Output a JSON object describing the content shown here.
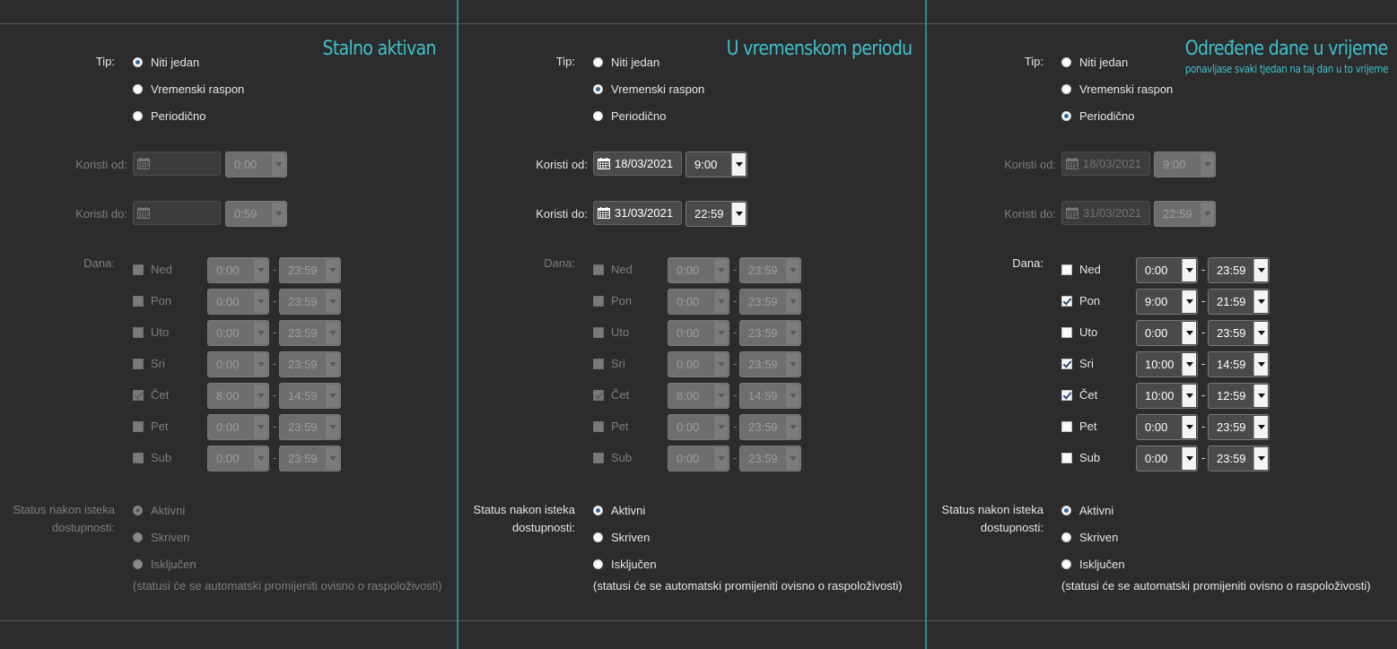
{
  "labels": {
    "tip": "Tip:",
    "koristi_od": "Koristi od:",
    "koristi_do": "Koristi do:",
    "dana": "Dana:",
    "status_line1": "Status nakon isteka",
    "status_line2": "dostupnosti:"
  },
  "type_options": [
    "Niti jedan",
    "Vremenski raspon",
    "Periodično"
  ],
  "status_options": [
    "Aktivni",
    "Skriven",
    "Isključen"
  ],
  "note": "(statusi će se automatski promijeniti ovisno o raspoloživosti)",
  "dash": "-",
  "panels": [
    {
      "title": "Stalno aktivan",
      "subtitle": "",
      "selected_type": 0,
      "from_date": "",
      "from_time": "0:00",
      "to_date": "",
      "to_time": "0:59",
      "days": [
        {
          "label": "Ned",
          "checked": false,
          "start": "0:00",
          "end": "23:59"
        },
        {
          "label": "Pon",
          "checked": false,
          "start": "0:00",
          "end": "23:59"
        },
        {
          "label": "Uto",
          "checked": false,
          "start": "0:00",
          "end": "23:59"
        },
        {
          "label": "Sri",
          "checked": false,
          "start": "0:00",
          "end": "23:59"
        },
        {
          "label": "Čet",
          "checked": true,
          "start": "8:00",
          "end": "14:59"
        },
        {
          "label": "Pet",
          "checked": false,
          "start": "0:00",
          "end": "23:59"
        },
        {
          "label": "Sub",
          "checked": false,
          "start": "0:00",
          "end": "23:59"
        }
      ],
      "status_selected": 0
    },
    {
      "title": "U vremenskom periodu",
      "subtitle": "",
      "selected_type": 1,
      "from_date": "18/03/2021",
      "from_time": "9:00",
      "to_date": "31/03/2021",
      "to_time": "22:59",
      "days": [
        {
          "label": "Ned",
          "checked": false,
          "start": "0:00",
          "end": "23:59"
        },
        {
          "label": "Pon",
          "checked": false,
          "start": "0:00",
          "end": "23:59"
        },
        {
          "label": "Uto",
          "checked": false,
          "start": "0:00",
          "end": "23:59"
        },
        {
          "label": "Sri",
          "checked": false,
          "start": "0:00",
          "end": "23:59"
        },
        {
          "label": "Čet",
          "checked": true,
          "start": "8:00",
          "end": "14:59"
        },
        {
          "label": "Pet",
          "checked": false,
          "start": "0:00",
          "end": "23:59"
        },
        {
          "label": "Sub",
          "checked": false,
          "start": "0:00",
          "end": "23:59"
        }
      ],
      "status_selected": 0
    },
    {
      "title": "Određene dane u vrijeme",
      "subtitle": "ponavljase svaki tjedan na taj dan u to vrijeme",
      "selected_type": 2,
      "from_date": "18/03/2021",
      "from_time": "9:00",
      "to_date": "31/03/2021",
      "to_time": "22:59",
      "days": [
        {
          "label": "Ned",
          "checked": false,
          "start": "0:00",
          "end": "23:59"
        },
        {
          "label": "Pon",
          "checked": true,
          "start": "9:00",
          "end": "21:59"
        },
        {
          "label": "Uto",
          "checked": false,
          "start": "0:00",
          "end": "23:59"
        },
        {
          "label": "Sri",
          "checked": true,
          "start": "10:00",
          "end": "14:59"
        },
        {
          "label": "Čet",
          "checked": true,
          "start": "10:00",
          "end": "12:59"
        },
        {
          "label": "Pet",
          "checked": false,
          "start": "0:00",
          "end": "23:59"
        },
        {
          "label": "Sub",
          "checked": false,
          "start": "0:00",
          "end": "23:59"
        }
      ],
      "status_selected": 0
    }
  ]
}
